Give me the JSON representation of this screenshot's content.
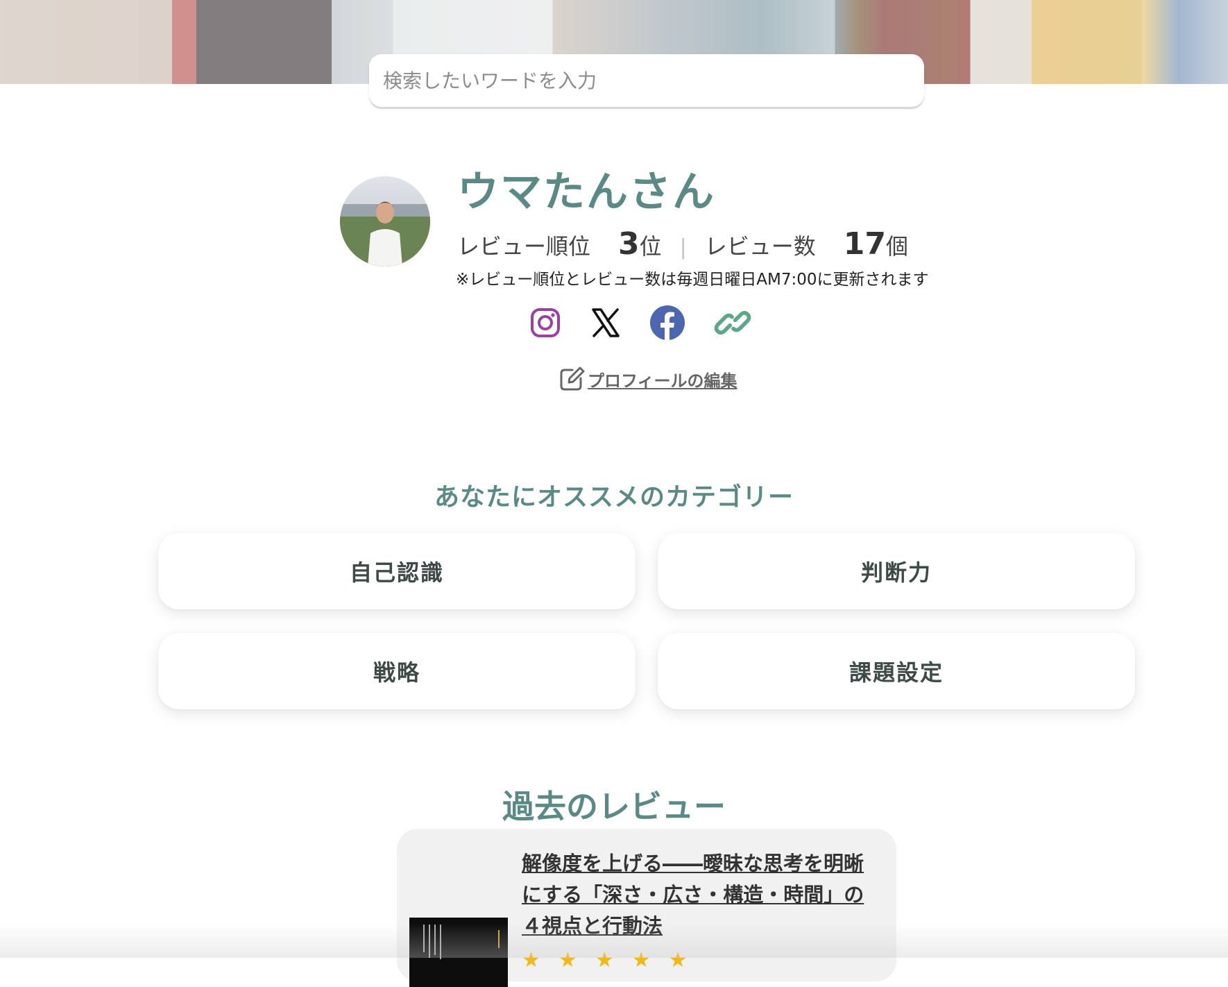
{
  "search": {
    "placeholder": "検索したいワードを入力",
    "value": ""
  },
  "profile": {
    "name": "ウマたんさん",
    "rank_label": "レビュー順位",
    "rank_value": "3",
    "rank_unit": "位",
    "count_label": "レビュー数",
    "count_value": "17",
    "count_unit": "個",
    "note": "※レビュー順位とレビュー数は毎週日曜日AM7:00に更新されます",
    "edit_label": "プロフィールの編集"
  },
  "social_icons": [
    "instagram-icon",
    "x-icon",
    "facebook-icon",
    "link-icon"
  ],
  "categories": {
    "title": "あなたにオススメのカテゴリー",
    "items": [
      "自己認識",
      "判断力",
      "戦略",
      "課題設定"
    ]
  },
  "past_reviews": {
    "title": "過去のレビュー",
    "items": [
      {
        "title": "解像度を上げる――曖昧な思考を明晰にする「深さ・広さ・構造・時間」の４視点と行動法",
        "rating": 5
      }
    ]
  },
  "colors": {
    "accent": "#5a8a85",
    "instagram": "#9b3fa3",
    "facebook": "#4c66b0",
    "link": "#5aa889",
    "star": "#f5b80f"
  }
}
